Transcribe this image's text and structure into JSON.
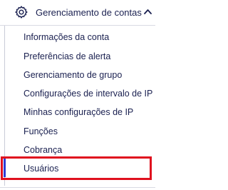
{
  "menu": {
    "header_label": "Gerenciamento de contas",
    "header_icon": "gear-icon",
    "expand_icon": "chevron-up-icon",
    "items": [
      {
        "label": "Informações da conta"
      },
      {
        "label": "Preferências de alerta"
      },
      {
        "label": "Gerenciamento de grupo"
      },
      {
        "label": "Configurações de intervalo de IP"
      },
      {
        "label": "Minhas configurações de IP"
      },
      {
        "label": "Funções"
      },
      {
        "label": "Cobrança"
      },
      {
        "label": "Usuários"
      }
    ],
    "active_item": "Usuários"
  },
  "colors": {
    "text": "#1a2050",
    "active_bar": "#2b3dd6",
    "highlight_border": "#e0101e",
    "rule": "#d9dbe3"
  }
}
